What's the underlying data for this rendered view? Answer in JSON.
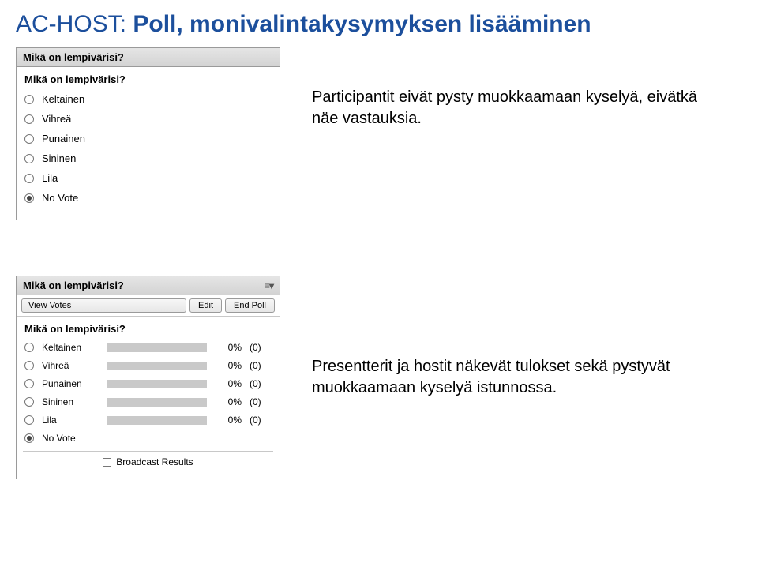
{
  "title_prefix": "AC-HOST: ",
  "title_bold": "Poll, monivalintakysymyksen lisääminen",
  "poll_title": "Mikä on lempivärisi?",
  "poll_question": "Mikä on lempivärisi?",
  "participant_options": [
    {
      "label": "Keltainen",
      "selected": false
    },
    {
      "label": "Vihreä",
      "selected": false
    },
    {
      "label": "Punainen",
      "selected": false
    },
    {
      "label": "Sininen",
      "selected": false
    },
    {
      "label": "Lila",
      "selected": false
    },
    {
      "label": "No Vote",
      "selected": true
    }
  ],
  "caption_participant": "Participantit eivät pysty muokkaamaan kyselyä, eivätkä näe vastauksia.",
  "host_toolbar": {
    "view_votes": "View Votes",
    "edit": "Edit",
    "end_poll": "End Poll"
  },
  "host_results": [
    {
      "label": "Keltainen",
      "pct": "0%",
      "count": "(0)"
    },
    {
      "label": "Vihreä",
      "pct": "0%",
      "count": "(0)"
    },
    {
      "label": "Punainen",
      "pct": "0%",
      "count": "(0)"
    },
    {
      "label": "Sininen",
      "pct": "0%",
      "count": "(0)"
    },
    {
      "label": "Lila",
      "pct": "0%",
      "count": "(0)"
    }
  ],
  "host_novote": "No Vote",
  "broadcast_label": "Broadcast Results",
  "caption_host": "Presentterit ja hostit näkevät tulokset sekä pystyvät muokkaamaan kyselyä istunnossa."
}
